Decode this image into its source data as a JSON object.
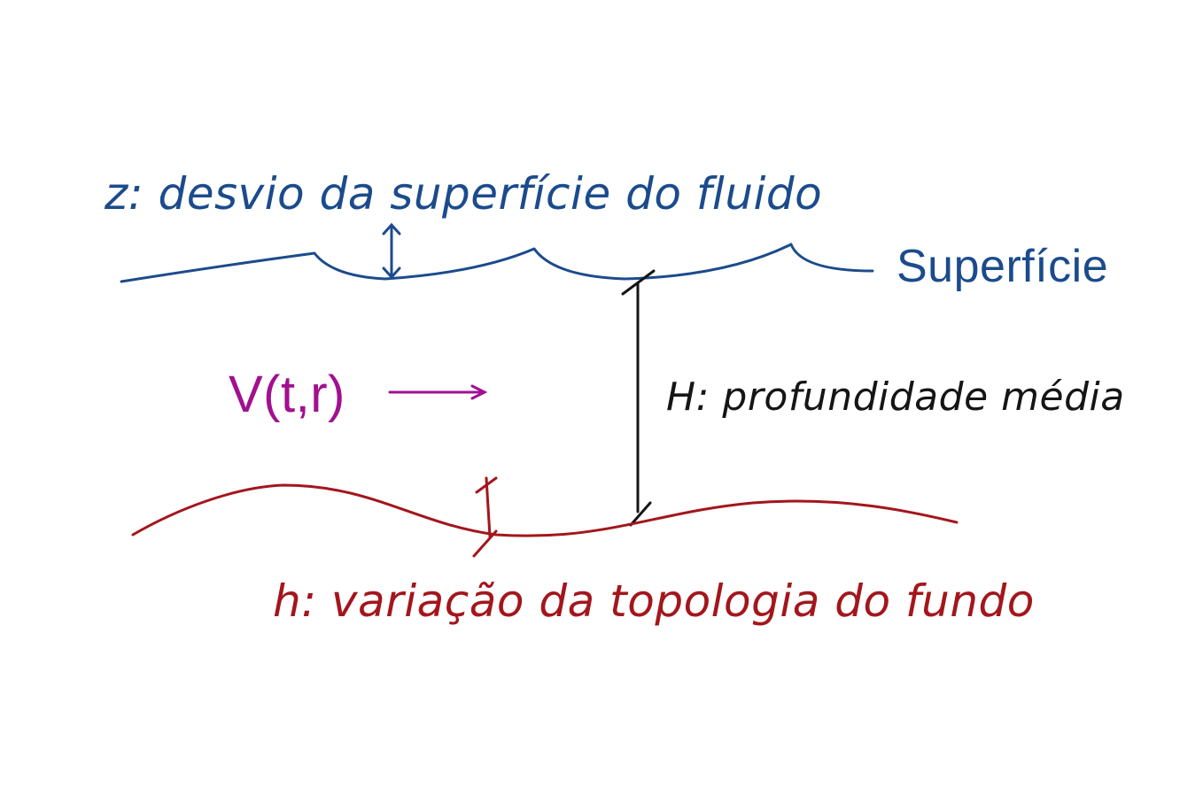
{
  "colors": {
    "surface": "#1b4b8c",
    "bottom": "#a3161c",
    "velocity": "#a0118f",
    "depth": "#151515",
    "background": "#ffffff"
  },
  "labels": {
    "z": "z: desvio da superfície do fluido",
    "surface": "Superfície",
    "velocity": "V(t,r)",
    "depth": "H: profundidade média",
    "bottom": "h: variação da topologia do fundo"
  }
}
